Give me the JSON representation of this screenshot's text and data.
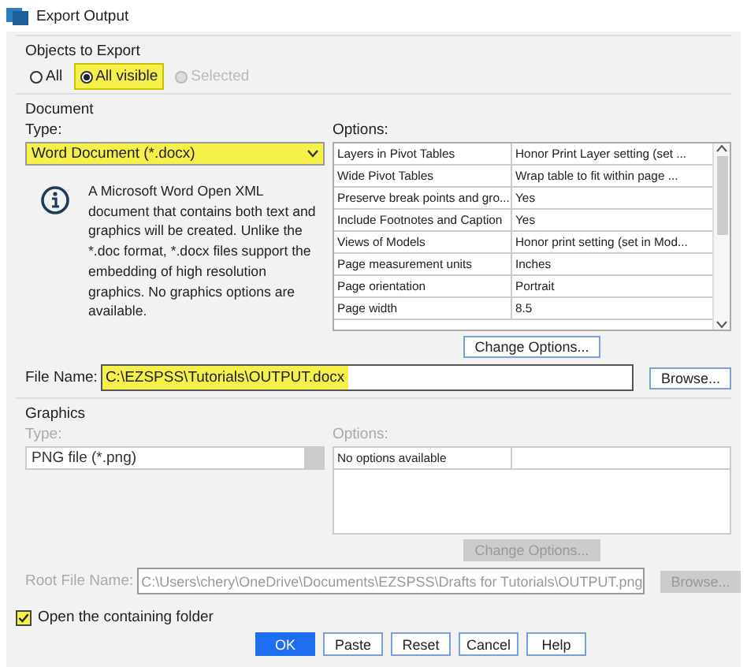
{
  "window": {
    "title": "Export Output"
  },
  "objects_to_export": {
    "label": "Objects to Export",
    "options": [
      {
        "label": "All",
        "selected": false,
        "disabled": false,
        "highlighted": false
      },
      {
        "label": "All visible",
        "selected": true,
        "disabled": false,
        "highlighted": true
      },
      {
        "label": "Selected",
        "selected": false,
        "disabled": true,
        "highlighted": false
      }
    ]
  },
  "document": {
    "label": "Document",
    "type_label": "Type:",
    "type_value": "Word Document (*.docx)",
    "type_highlighted": true,
    "info_text": "A Microsoft Word Open XML document that contains both text and graphics will be created. Unlike the *.doc format, *.docx files support the embedding of high resolution graphics. No graphics options are available.",
    "options_label": "Options:",
    "options_rows": [
      {
        "name": "Layers in Pivot Tables",
        "value": "Honor Print Layer setting (set ..."
      },
      {
        "name": "Wide Pivot Tables",
        "value": "Wrap table to fit within page ..."
      },
      {
        "name": "Preserve break points and gro...",
        "value": "Yes"
      },
      {
        "name": "Include Footnotes and Caption",
        "value": "Yes"
      },
      {
        "name": "Views of Models",
        "value": "Honor print setting (set in Mod..."
      },
      {
        "name": "Page measurement units",
        "value": "Inches"
      },
      {
        "name": "Page orientation",
        "value": "Portrait"
      },
      {
        "name": "Page width",
        "value": "8.5"
      }
    ],
    "change_options_button": "Change Options...",
    "file_name_label": "File Name:",
    "file_name_value": "C:\\EZSPSS\\Tutorials\\OUTPUT.docx",
    "file_name_highlighted": true,
    "browse_button": "Browse..."
  },
  "graphics": {
    "label": "Graphics",
    "disabled": true,
    "type_label": "Type:",
    "type_value": "PNG file (*.png)",
    "options_label": "Options:",
    "options_text": "No options available",
    "change_options_button": "Change Options...",
    "root_file_name_label": "Root File Name:",
    "root_file_name_value": "C:\\Users\\chery\\OneDrive\\Documents\\EZSPSS\\Drafts for Tutorials\\OUTPUT.png",
    "browse_button": "Browse..."
  },
  "open_folder": {
    "label": "Open the containing folder",
    "checked": true,
    "highlighted": true
  },
  "buttons": [
    {
      "label": "OK",
      "kind": "primary"
    },
    {
      "label": "Paste",
      "kind": "normal"
    },
    {
      "label": "Reset",
      "kind": "normal"
    },
    {
      "label": "Cancel",
      "kind": "normal"
    },
    {
      "label": "Help",
      "kind": "normal"
    }
  ]
}
